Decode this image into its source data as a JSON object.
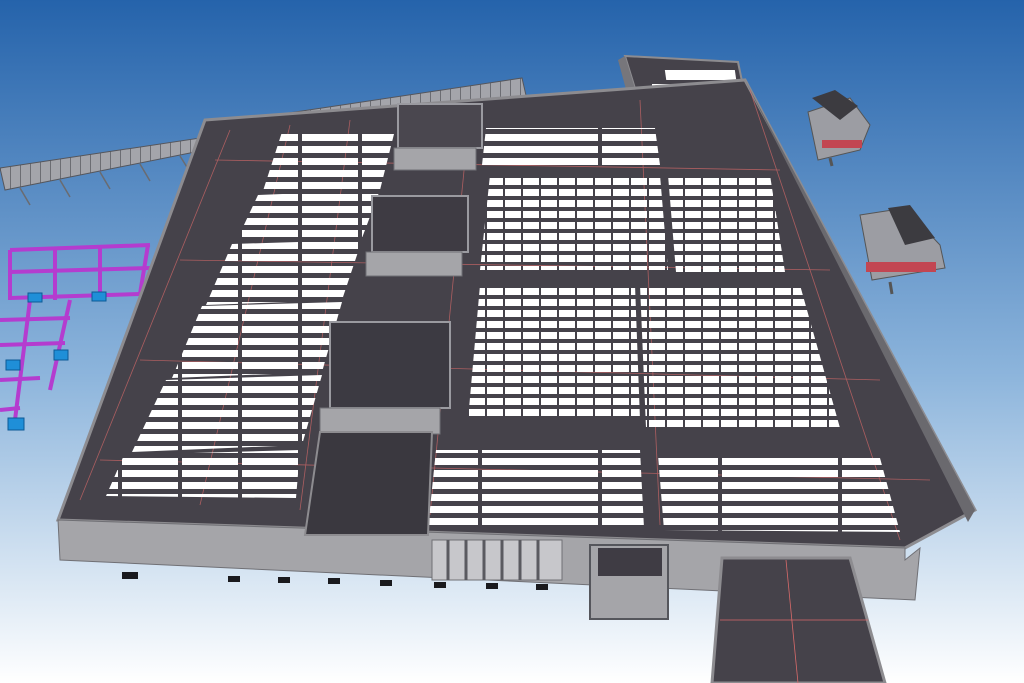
{
  "viewer": {
    "background_top": "#2563ab",
    "background_bottom": "#ffffff",
    "roof_color": "#45424a",
    "roof_edge_color": "#8d8c90",
    "wall_color": "#a5a5a9",
    "panel_color": "#ffffff",
    "structure_color": "#b43ccf",
    "footing_color": "#1f8fd8",
    "gridline_color": "#d86a6a",
    "walkway_color": "#9a9ba1"
  }
}
